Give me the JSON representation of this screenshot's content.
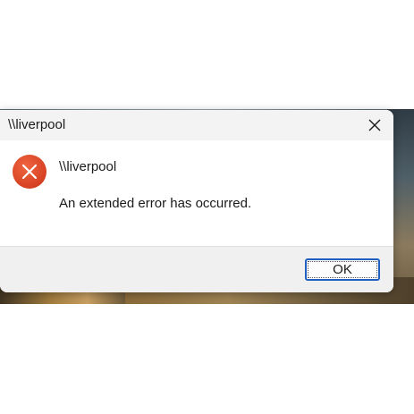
{
  "window": {
    "title": "\\\\liverpool"
  },
  "dialog": {
    "icon": "error-icon",
    "heading": "\\\\liverpool",
    "message": "An extended error has occurred."
  },
  "buttons": {
    "ok_label": "OK",
    "close_icon": "close-icon"
  },
  "colors": {
    "error_icon": "#e0462a",
    "accent": "#1f5fbf"
  }
}
